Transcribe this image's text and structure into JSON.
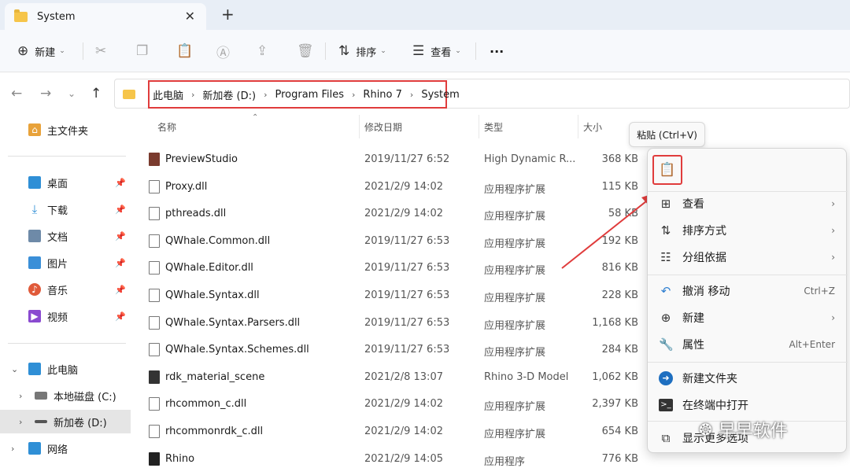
{
  "tab": {
    "title": "System",
    "close": "✕",
    "new_tab": "+"
  },
  "toolbar": {
    "new_label": "新建",
    "sort_label": "排序",
    "view_label": "查看",
    "more": "···"
  },
  "address": {
    "crumbs": [
      "此电脑",
      "新加卷 (D:)",
      "Program Files",
      "Rhino 7",
      "System"
    ]
  },
  "sidebar": {
    "home": "主文件夹",
    "quick": [
      {
        "label": "桌面",
        "color": "#2f8fd6"
      },
      {
        "label": "下载",
        "color": "#2f8fd6"
      },
      {
        "label": "文档",
        "color": "#6e8aa8"
      },
      {
        "label": "图片",
        "color": "#3a8fd8"
      },
      {
        "label": "音乐",
        "color": "#e05a3a"
      },
      {
        "label": "视频",
        "color": "#8a4ad0"
      }
    ],
    "this_pc": "此电脑",
    "drive_c": "本地磁盘 (C:)",
    "drive_d": "新加卷 (D:)",
    "network": "网络"
  },
  "columns": {
    "name": "名称",
    "date": "修改日期",
    "type": "类型",
    "size": "大小"
  },
  "files": [
    {
      "name": "PreviewStudio",
      "date": "2019/11/27 6:52",
      "type": "High Dynamic R...",
      "size": "368 KB",
      "icon": "app"
    },
    {
      "name": "Proxy.dll",
      "date": "2021/2/9 14:02",
      "type": "应用程序扩展",
      "size": "115 KB",
      "icon": "dll"
    },
    {
      "name": "pthreads.dll",
      "date": "2021/2/9 14:02",
      "type": "应用程序扩展",
      "size": "58 KB",
      "icon": "dll"
    },
    {
      "name": "QWhale.Common.dll",
      "date": "2019/11/27 6:53",
      "type": "应用程序扩展",
      "size": "192 KB",
      "icon": "dll"
    },
    {
      "name": "QWhale.Editor.dll",
      "date": "2019/11/27 6:53",
      "type": "应用程序扩展",
      "size": "816 KB",
      "icon": "dll"
    },
    {
      "name": "QWhale.Syntax.dll",
      "date": "2019/11/27 6:53",
      "type": "应用程序扩展",
      "size": "228 KB",
      "icon": "dll"
    },
    {
      "name": "QWhale.Syntax.Parsers.dll",
      "date": "2019/11/27 6:53",
      "type": "应用程序扩展",
      "size": "1,168 KB",
      "icon": "dll"
    },
    {
      "name": "QWhale.Syntax.Schemes.dll",
      "date": "2019/11/27 6:53",
      "type": "应用程序扩展",
      "size": "284 KB",
      "icon": "dll"
    },
    {
      "name": "rdk_material_scene",
      "date": "2021/2/8 13:07",
      "type": "Rhino 3-D Model",
      "size": "1,062 KB",
      "icon": "dark"
    },
    {
      "name": "rhcommon_c.dll",
      "date": "2021/2/9 14:02",
      "type": "应用程序扩展",
      "size": "2,397 KB",
      "icon": "dll"
    },
    {
      "name": "rhcommonrdk_c.dll",
      "date": "2021/2/9 14:02",
      "type": "应用程序扩展",
      "size": "654 KB",
      "icon": "dll"
    },
    {
      "name": "Rhino",
      "date": "2021/2/9 14:05",
      "type": "应用程序",
      "size": "776 KB",
      "icon": "rhino"
    }
  ],
  "tooltip": "粘贴 (Ctrl+V)",
  "context_menu": {
    "view": "查看",
    "sort": "排序方式",
    "group": "分组依据",
    "undo": "撤消 移动",
    "undo_shortcut": "Ctrl+Z",
    "new": "新建",
    "properties": "属性",
    "properties_shortcut": "Alt+Enter",
    "new_folder": "新建文件夹",
    "terminal": "在终端中打开",
    "more_options": "显示更多选项"
  },
  "watermark": "早早软件",
  "accent": "#e03c3c"
}
